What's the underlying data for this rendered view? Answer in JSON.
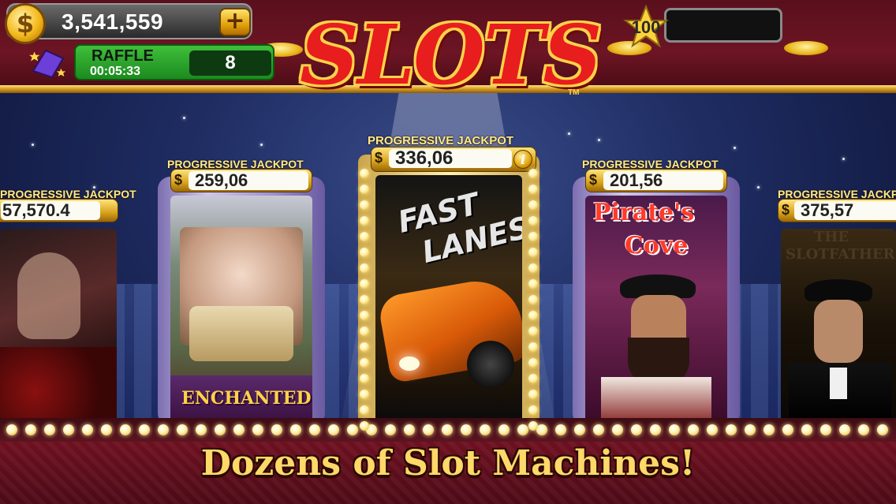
{
  "header": {
    "coin_symbol": "$",
    "coins": "3,541,559",
    "add_coins_label": "+",
    "raffle_label": "RAFFLE",
    "raffle_timer": "00:05:33",
    "raffle_tickets": "8",
    "level": "100",
    "logo_text": "SLOTS",
    "logo_tm": "TM"
  },
  "machines": [
    {
      "name": "left-cutoff",
      "jackpot_label": "PROGRESSIVE JACKPOT",
      "jackpot_value": "57,570.4",
      "art_title": ""
    },
    {
      "name": "enchanted",
      "jackpot_label": "PROGRESSIVE JACKPOT",
      "jackpot_currency": "$",
      "jackpot_value": "259,06",
      "art_title": "ENCHANTED"
    },
    {
      "name": "fast-lanes",
      "jackpot_label": "PROGRESSIVE JACKPOT",
      "jackpot_currency": "$",
      "jackpot_value": "336,06",
      "info_label": "i",
      "art_title_1": "FAST",
      "art_title_2": "LANES"
    },
    {
      "name": "pirates-cove",
      "jackpot_label": "PROGRESSIVE JACKPOT",
      "jackpot_currency": "$",
      "jackpot_value": "201,56",
      "art_title_1": "Pirate's",
      "art_title_2": "Cove"
    },
    {
      "name": "slotfather",
      "jackpot_label": "PROGRESSIVE JACKPOT",
      "jackpot_currency": "$",
      "jackpot_value": "375,57",
      "art_title_1": "THE",
      "art_title_2": "SLOTFATHER"
    }
  ],
  "footer": {
    "tagline": "Dozens of Slot Machines!"
  },
  "colors": {
    "topbar": "#6d1524",
    "gold": "#e2a20d",
    "raffle_green": "#1c8a1f",
    "logo_red": "#e81d1d",
    "tagline_gold": "#ffd86a"
  }
}
